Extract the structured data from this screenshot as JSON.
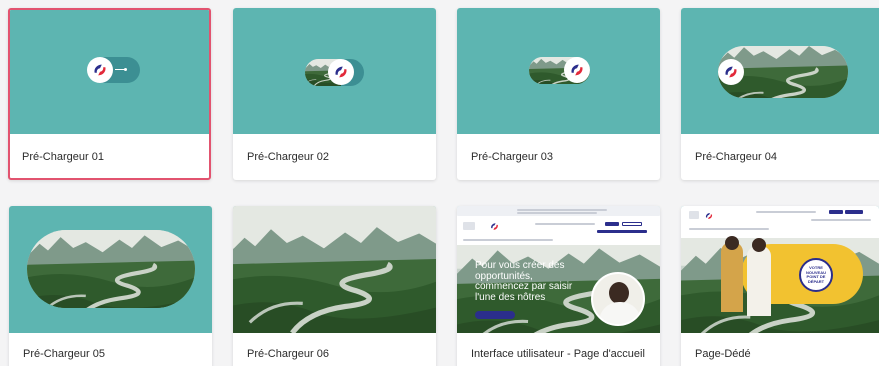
{
  "cards": [
    {
      "title": "Pré-Chargeur 01"
    },
    {
      "title": "Pré-Chargeur 02"
    },
    {
      "title": "Pré-Chargeur 03"
    },
    {
      "title": "Pré-Chargeur 04"
    },
    {
      "title": "Pré-Chargeur 05"
    },
    {
      "title": "Pré-Chargeur 06"
    },
    {
      "title": "Interface utilisateur - Page d'accueil"
    },
    {
      "title": "Page-Dédé"
    }
  ],
  "mockups": {
    "home_hero_text": "Pour vous créer des opportunités, commencez par saisir l'une des nôtres",
    "brand_name": "France Volontaires",
    "dedicated_badge": "VOTRE NOUVEAU POINT DE DÉPART"
  },
  "colors": {
    "teal": "#5db5b1",
    "pill": "#3c8f93",
    "selected_border": "#e2536f",
    "brand_blue": "#2b2e8c",
    "brand_red": "#e2293a",
    "yellow": "#f2c230"
  }
}
